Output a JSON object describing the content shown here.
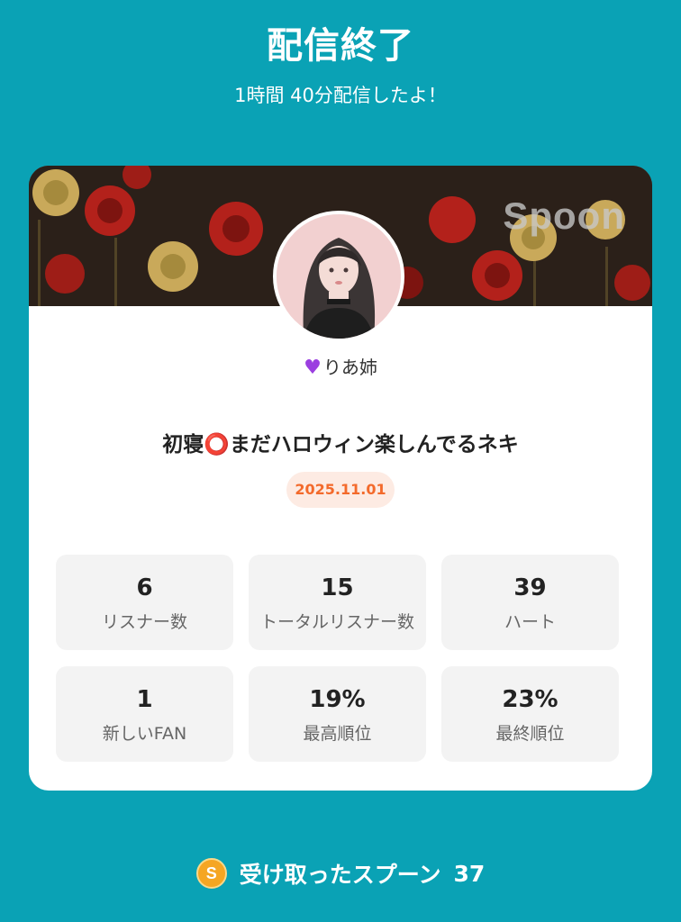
{
  "header": {
    "title": "配信終了",
    "subtitle": "1時間 40分配信したよ！"
  },
  "card": {
    "brand": "Spoon",
    "host_icon": "purple-heart",
    "host_name": "りあ姉",
    "stream_title": "初寝⭕️まだハロウィン楽しんでるネキ",
    "date": "2025.11.01"
  },
  "stats": [
    {
      "value": "6",
      "label": "リスナー数"
    },
    {
      "value": "15",
      "label": "トータルリスナー数"
    },
    {
      "value": "39",
      "label": "ハート"
    },
    {
      "value": "1",
      "label": "新しいFAN"
    },
    {
      "value": "19%",
      "label": "最高順位"
    },
    {
      "value": "23%",
      "label": "最終順位"
    }
  ],
  "footer": {
    "coin_icon": "S",
    "label": "受け取ったスプーン",
    "count": "37"
  },
  "colors": {
    "background": "#0aa2b5",
    "date_text": "#f36a2b",
    "date_bg": "#fdebe3",
    "coin": "#f5a623"
  }
}
